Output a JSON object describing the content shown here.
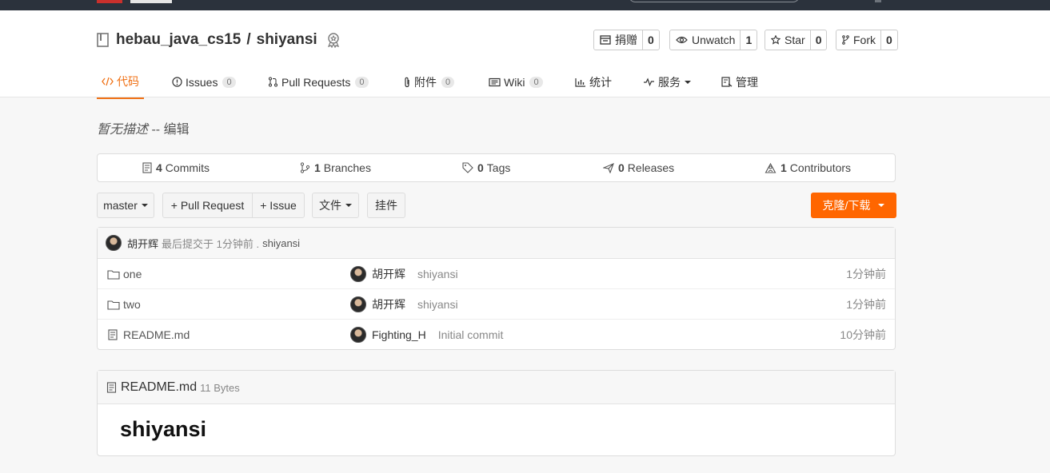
{
  "repo": {
    "owner": "hebau_java_cs15",
    "separator": "/",
    "name": "shiyansi"
  },
  "actions": [
    {
      "label": "捐赠",
      "count": "0",
      "icon": "donate-icon"
    },
    {
      "label": "Unwatch",
      "count": "1",
      "icon": "eye-icon"
    },
    {
      "label": "Star",
      "count": "0",
      "icon": "star-icon"
    },
    {
      "label": "Fork",
      "count": "0",
      "icon": "fork-icon"
    }
  ],
  "tabs": [
    {
      "label": "代码",
      "icon": "code-icon",
      "active": true
    },
    {
      "label": "Issues",
      "count": "0",
      "icon": "issues-icon"
    },
    {
      "label": "Pull Requests",
      "count": "0",
      "icon": "pull-request-icon"
    },
    {
      "label": "附件",
      "count": "0",
      "icon": "attachment-icon"
    },
    {
      "label": "Wiki",
      "count": "0",
      "icon": "wiki-icon"
    },
    {
      "label": "统计",
      "icon": "stats-icon"
    },
    {
      "label": "服务",
      "icon": "pulse-icon"
    },
    {
      "label": "管理",
      "icon": "admin-icon"
    }
  ],
  "description": {
    "text": "暂无描述",
    "separator": " -- ",
    "edit_label": "编辑"
  },
  "stats": [
    {
      "count": "4",
      "label": "Commits",
      "icon": "commits-icon"
    },
    {
      "count": "1",
      "label": "Branches",
      "icon": "branch-icon"
    },
    {
      "count": "0",
      "label": "Tags",
      "icon": "tag-icon"
    },
    {
      "count": "0",
      "label": "Releases",
      "icon": "release-icon"
    },
    {
      "count": "1",
      "label": "Contributors",
      "icon": "contributors-icon"
    }
  ],
  "toolbar": {
    "branch": "master",
    "pull_request": "+ Pull Request",
    "issue": "+ Issue",
    "files": "文件",
    "widget": "挂件",
    "clone": "克隆/下载"
  },
  "latest_commit": {
    "author": "胡开辉",
    "text": "最后提交于 1分钟前 .",
    "message": "shiyansi"
  },
  "files": [
    {
      "name": "one",
      "type": "folder",
      "author": "胡开辉",
      "message": "shiyansi",
      "time": "1分钟前"
    },
    {
      "name": "two",
      "type": "folder",
      "author": "胡开辉",
      "message": "shiyansi",
      "time": "1分钟前"
    },
    {
      "name": "README.md",
      "type": "file",
      "author": "Fighting_H",
      "message": "Initial commit",
      "time": "10分钟前"
    }
  ],
  "readme": {
    "filename": "README.md",
    "size": "11 Bytes",
    "heading": "shiyansi"
  },
  "colors": {
    "accent": "#f07014",
    "clone_button": "#ff6600",
    "topbar": "#2b323c"
  }
}
